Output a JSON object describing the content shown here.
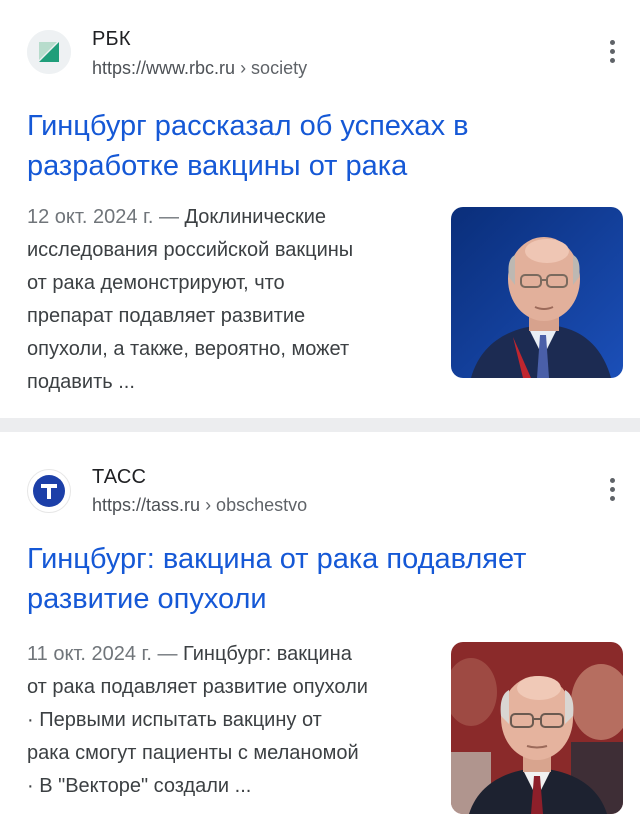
{
  "results": [
    {
      "site_name": "РБК",
      "url": "https://www.rbc.ru",
      "breadcrumb": "› society",
      "title_line1": "Гинцбург рассказал об успехах в",
      "title_line2": "разработке вакцины от рака",
      "date": "12 окт. 2024 г. —",
      "snippet_lines": [
        " Доклинические",
        "исследования российской вакцины",
        "от рака демонстрируют, что",
        "препарат подавляет развитие",
        "опухоли, а также, вероятно, может",
        "подавить ..."
      ],
      "favicon": "rbc-logo-icon",
      "thumbnail": "man-portrait-blue-background"
    },
    {
      "site_name": "ТАСС",
      "url": "https://tass.ru",
      "breadcrumb": "› obschestvo",
      "title_line1": "Гинцбург: вакцина от рака подавляет",
      "title_line2": "развитие опухоли",
      "date": "11 окт. 2024 г. —",
      "snippet_lines": [
        " Гинцбург: вакцина",
        "от рака подавляет развитие опухоли",
        "· Первыми испытать вакцину от",
        "рака смогут пациенты с меланомой",
        "· В \"Векторе\" создали ..."
      ],
      "favicon": "tass-logo-icon",
      "thumbnail": "man-with-glasses-portrait"
    }
  ],
  "colors": {
    "title_link": "#1558d6",
    "url_text": "#4d5156",
    "snippet_text": "#3c4043",
    "date_text": "#70757a",
    "divider": "#ecedef",
    "tass_blue": "#1c3fa8"
  }
}
